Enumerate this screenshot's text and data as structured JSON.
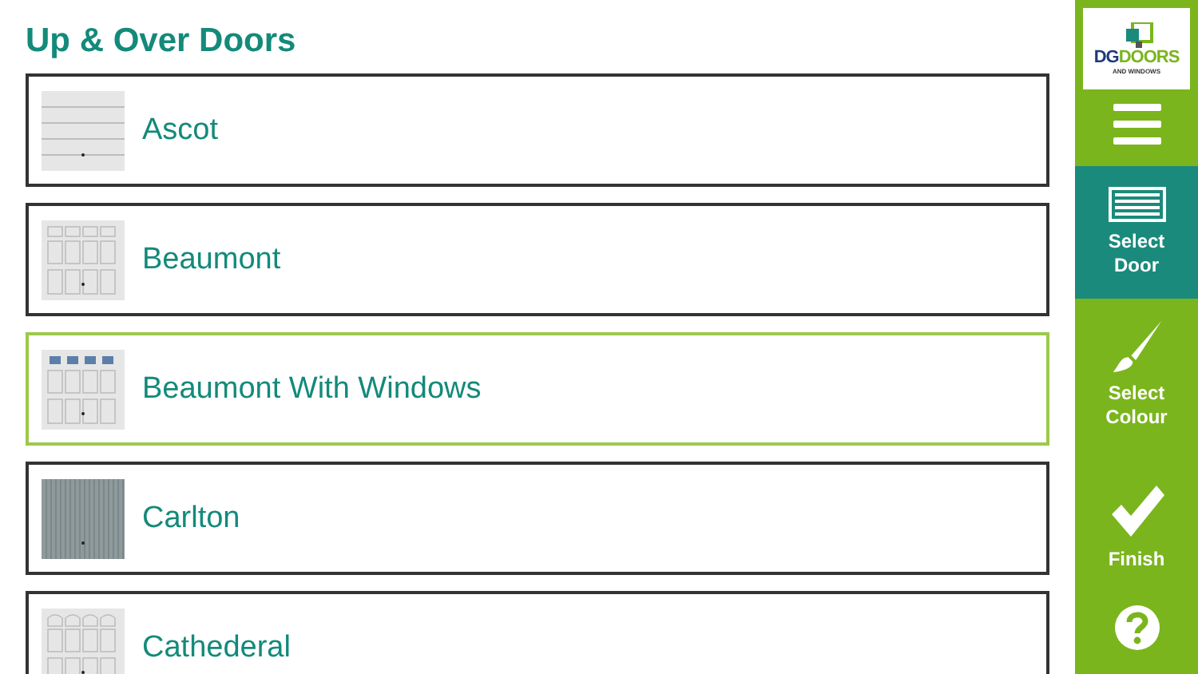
{
  "title": "Up & Over Doors",
  "doors": [
    {
      "name": "Ascot",
      "kind": "horizontal",
      "selected": false
    },
    {
      "name": "Beaumont",
      "kind": "panel",
      "selected": false
    },
    {
      "name": "Beaumont With Windows",
      "kind": "windows",
      "selected": true
    },
    {
      "name": "Carlton",
      "kind": "ribbed",
      "selected": false
    },
    {
      "name": "Cathederal",
      "kind": "arched",
      "selected": false
    }
  ],
  "logo": {
    "prefix": "DG",
    "name": "DOORS",
    "tagline": "AND WINDOWS"
  },
  "nav": [
    {
      "kind": "menu",
      "selected": false
    },
    {
      "kind": "door",
      "label": "Select Door",
      "selected": true
    },
    {
      "kind": "brush",
      "label": "Select Colour",
      "selected": false
    },
    {
      "kind": "check",
      "label": "Finish",
      "selected": false
    },
    {
      "kind": "help",
      "selected": false
    }
  ]
}
